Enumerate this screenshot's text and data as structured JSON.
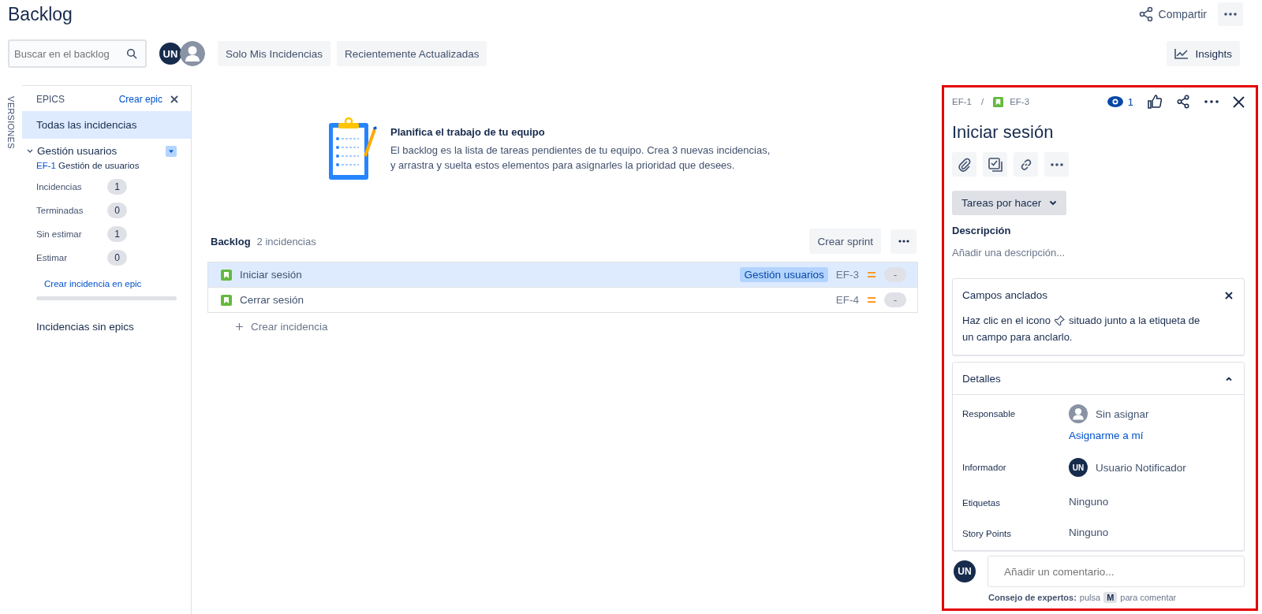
{
  "page": {
    "title": "Backlog",
    "share": "Compartir"
  },
  "toolbar": {
    "search": {
      "placeholder": "Buscar en el backlog"
    },
    "avatars": [
      {
        "kind": "initials",
        "initials": "UN"
      },
      {
        "kind": "anonymous"
      }
    ],
    "filters": [
      {
        "label": "Solo Mis Incidencias",
        "selected": false
      },
      {
        "label": "Recientemente Actualizadas",
        "selected": false
      }
    ],
    "insights": "Insights"
  },
  "versions_tab": "VERSIONES",
  "epics_panel": {
    "title": "EPICS",
    "create": "Crear epic",
    "all": {
      "label": "Todas las incidencias",
      "selected": true
    },
    "epic": {
      "name": "Gestión usuarios",
      "expanded": true,
      "key": "EF-1",
      "summary": "Gestión de usuarios",
      "stats": [
        {
          "label": "Incidencias",
          "count": "1"
        },
        {
          "label": "Terminadas",
          "count": "0"
        },
        {
          "label": "Sin estimar",
          "count": "1"
        },
        {
          "label": "Estimar",
          "count": "0"
        }
      ],
      "create_issue": "Crear incidencia en epic",
      "level": 0
    },
    "no_epic": {
      "label": "Incidencias sin epics",
      "selected": false
    }
  },
  "empty_state": {
    "title": "Planifica el trabajo de tu equipo",
    "lines": [
      "El backlog es la lista de tareas pendientes de tu equipo. Crea 3 nuevas incidencias,",
      "y arrastra y suelta estos elementos para asignarles la prioridad que desees."
    ]
  },
  "backlog": {
    "title": "Backlog",
    "count": "2 incidencias",
    "create_sprint": "Crear sprint",
    "issues": [
      {
        "summary": "Iniciar sesión",
        "epic": "Gestión usuarios",
        "key": "EF-3",
        "estimate": "-",
        "selected": true
      },
      {
        "summary": "Cerrar sesión",
        "key": "EF-4",
        "estimate": "-",
        "selected": false
      }
    ],
    "create": "Crear incidencia"
  },
  "detail": {
    "parent_key": "EF-1",
    "separator": "/",
    "key": "EF-3",
    "watchers": "1",
    "title": "Iniciar sesión",
    "status": "Tareas por hacer",
    "description_label": "Descripción",
    "description_placeholder": "Añadir una descripción...",
    "pinned": {
      "title": "Campos anclados",
      "before": "Haz clic en el icono",
      "after": "situado junto a la etiqueta de",
      "line2": "un campo para anclarlo."
    },
    "details": {
      "title": "Detalles",
      "expanded": true,
      "fields": [
        {
          "label": "Responsable",
          "kind": "user",
          "avatar": {
            "kind": "anonymous"
          },
          "value": "Sin asignar",
          "link": "Asignarme a mí"
        },
        {
          "label": "Informador",
          "kind": "user",
          "avatar": {
            "kind": "initials",
            "initials": "UN"
          },
          "value": "Usuario Notificador"
        },
        {
          "label": "Etiquetas",
          "kind": "text",
          "value": "Ninguno"
        },
        {
          "label": "Story Points",
          "kind": "text",
          "value": "Ninguno"
        }
      ]
    },
    "comment": {
      "initials": "UN",
      "placeholder": "Añadir un comentario...",
      "tip_label": "Consejo de expertos:",
      "tip_before": "pulsa",
      "tip_key": "M",
      "tip_after": "para comentar"
    }
  }
}
